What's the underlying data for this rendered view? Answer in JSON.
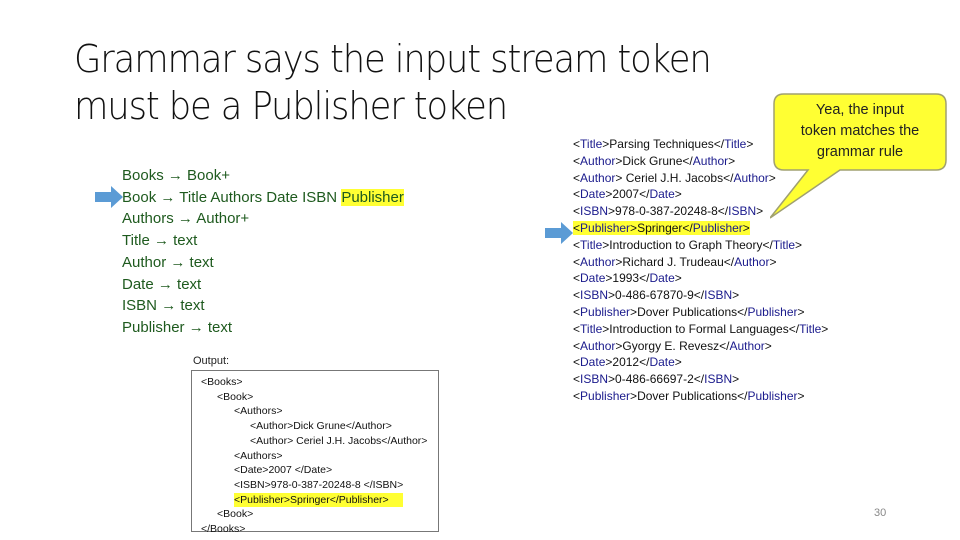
{
  "title": {
    "line1": "Grammar says the input stream token",
    "line2": "must be a Publisher token"
  },
  "grammar": {
    "rules": [
      {
        "lhs": "Books",
        "rhs": "Book+"
      },
      {
        "lhs": "Book",
        "rhs": "Title Authors Date ISBN",
        "highlighted_rhs": "Publisher"
      },
      {
        "lhs": "Authors",
        "rhs": "Author+"
      },
      {
        "lhs": "Title",
        "rhs": "text"
      },
      {
        "lhs": "Author",
        "rhs": "text"
      },
      {
        "lhs": "Date",
        "rhs": "text"
      },
      {
        "lhs": "ISBN",
        "rhs": "text"
      },
      {
        "lhs": "Publisher",
        "rhs": "text"
      }
    ],
    "arrow_symbol": "→",
    "pointer_icon": "right-arrow-icon"
  },
  "output": {
    "label": "Output:",
    "lines": [
      "<Books>",
      "<Book>",
      "<Authors>",
      "<Author>Dick Grune</Author>",
      "<Author> Ceriel J.H. Jacobs</Author>",
      "<Authors>",
      "<Date>2007 </Date>",
      "<ISBN>978-0-387-20248-8 </ISBN>",
      "<Publisher>Springer</Publisher>",
      "<Book>",
      "</Books>"
    ]
  },
  "input_stream": {
    "lines": [
      {
        "open": "<Title>",
        "text": "Parsing Techniques",
        "close": "</Title>"
      },
      {
        "open": "<Author>",
        "text": "Dick Grune",
        "close": "</Author>"
      },
      {
        "open": "<Author>",
        "text": " Ceriel J.H. Jacobs",
        "close": "</Author>"
      },
      {
        "open": "<Date>",
        "text": "2007",
        "close": "</Date>"
      },
      {
        "open": "<ISBN>",
        "text": "978-0-387-20248-8",
        "close": "</ISBN>"
      },
      {
        "open": "<Publisher>",
        "text": "Springer",
        "close": "</Publisher>"
      },
      {
        "open": "<Title>",
        "text": "Introduction to Graph Theory",
        "close": "</Title>"
      },
      {
        "open": "<Author>",
        "text": "Richard J. Trudeau",
        "close": "</Author>"
      },
      {
        "open": "<Date>",
        "text": "1993",
        "close": "</Date>"
      },
      {
        "open": "<ISBN>",
        "text": "0-486-67870-9",
        "close": "</ISBN>"
      },
      {
        "open": "<Publisher>",
        "text": "Dover Publications",
        "close": "</Publisher>"
      },
      {
        "open": "<Title>",
        "text": "Introduction to Formal Languages",
        "close": "</Title>"
      },
      {
        "open": "<Author>",
        "text": "Gyorgy E. Revesz",
        "close": "</Author>"
      },
      {
        "open": "<Date>",
        "text": "2012",
        "close": "</Date>"
      },
      {
        "open": "<ISBN>",
        "text": "0-486-66697-2",
        "close": "</ISBN>"
      },
      {
        "open": "<Publisher>",
        "text": "Dover Publications",
        "close": "</Publisher>"
      }
    ]
  },
  "callout": {
    "text_lines": [
      "Yea, the input",
      "token matches the",
      "grammar rule"
    ]
  },
  "page_number": "30",
  "colors": {
    "highlight": "#ffff33",
    "grammar_text": "#1e5a1e",
    "tag_text": "#1a1a8c",
    "arrow": "#5b9bd5",
    "callout_fill": "#ffff33",
    "callout_border": "#a0a070"
  }
}
